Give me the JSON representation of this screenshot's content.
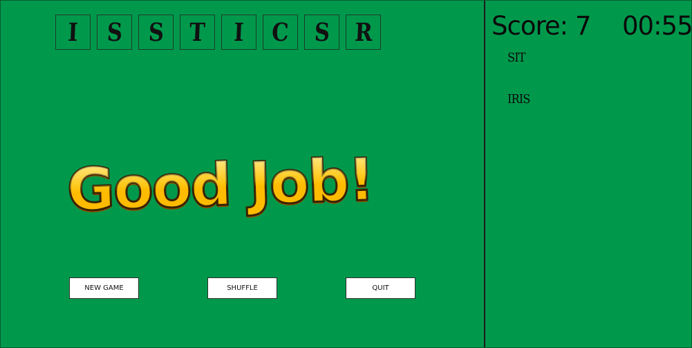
{
  "letters": [
    "I",
    "S",
    "S",
    "T",
    "I",
    "C",
    "S",
    "R"
  ],
  "message": "Good Job!",
  "buttons": {
    "new_game": "NEW GAME",
    "shuffle": "SHUFFLE",
    "quit": "QUIT"
  },
  "score": {
    "label": "Score:",
    "value": "7",
    "timer": "00:55"
  },
  "found_words": [
    "SIT",
    "IRIS"
  ],
  "colors": {
    "background": "#00994c",
    "message_fill": "#ffbb00",
    "divider": "#1a1a1a"
  }
}
